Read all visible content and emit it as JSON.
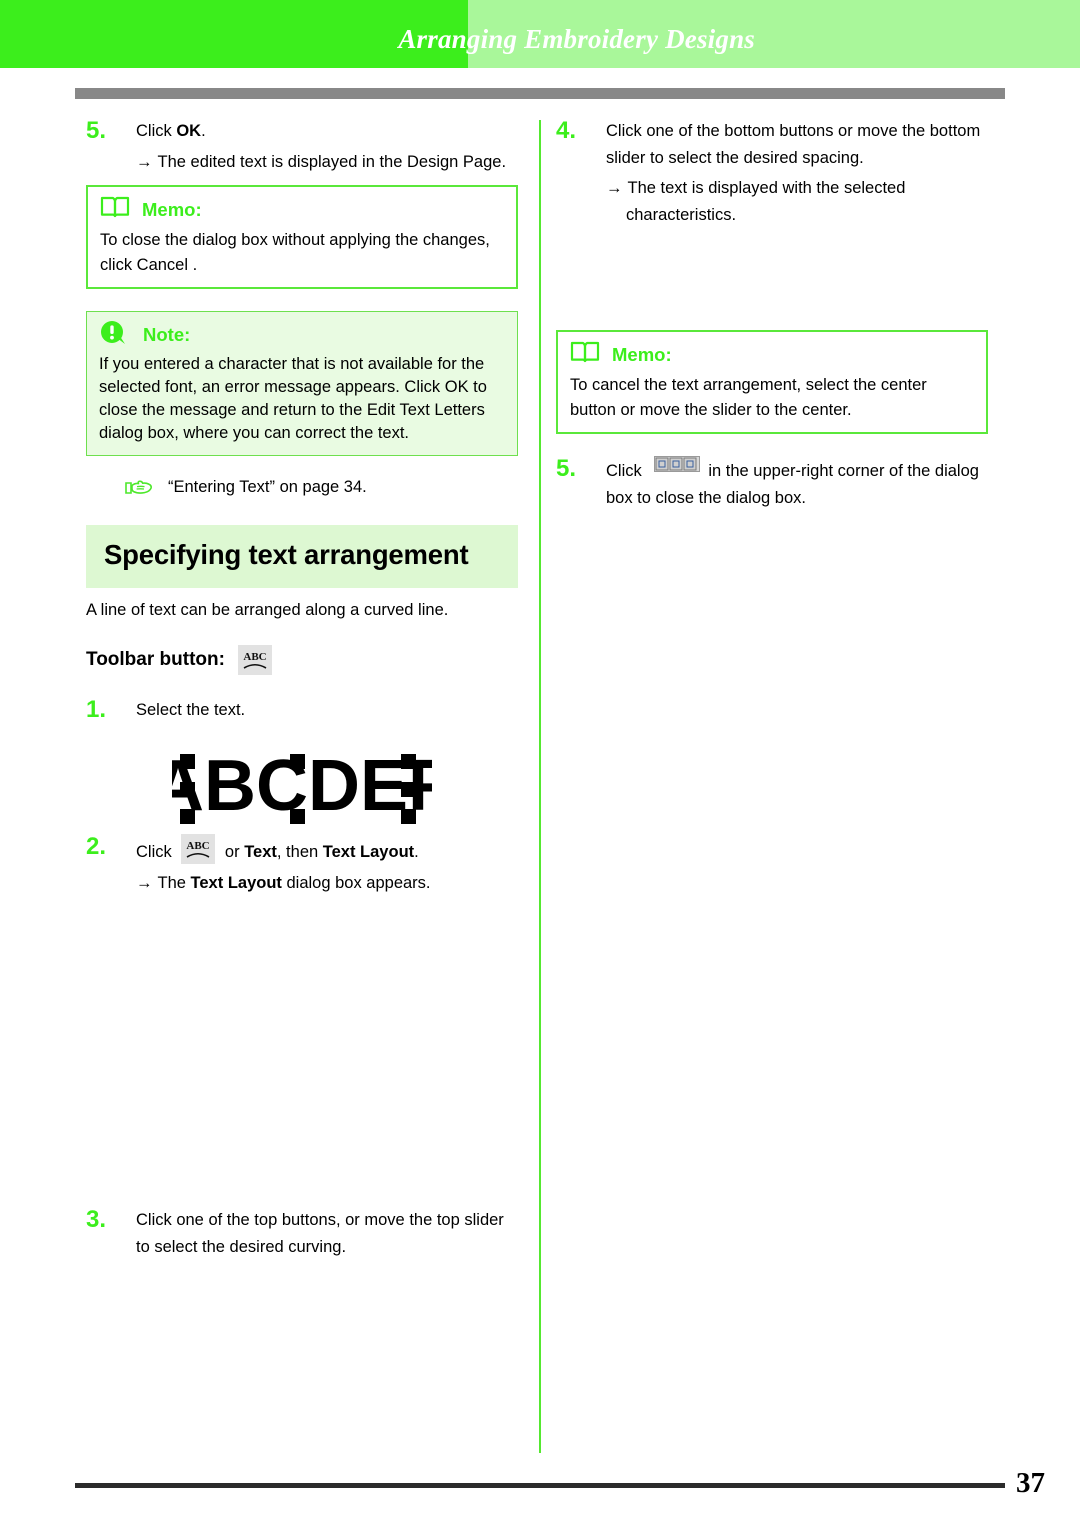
{
  "header": {
    "title": "Arranging Embroidery Designs",
    "accent_dark": "#3cee1c",
    "accent_light": "#a9f79a",
    "rule_color": "#888888"
  },
  "left_column": {
    "step5": {
      "number": "5.",
      "text_prefix": "Click ",
      "text_bold": "OK",
      "text_suffix": ".",
      "arrow": "→",
      "result": "The edited text is displayed in the Design Page."
    },
    "memo": {
      "icon": "book-icon",
      "title": "Memo:",
      "text": "To close the dialog box without applying the changes, click Cancel ."
    },
    "note": {
      "icon": "exclamation-icon",
      "title": "Note:",
      "text": "If you entered a character that is not available for the selected font, an error message appears. Click OK to close the message and return to the Edit Text Letters  dialog box, where you can correct the text."
    },
    "reference": {
      "icon": "pointing-hand-icon",
      "text": "“Entering Text” on page 34."
    },
    "section_heading": "Specifying text arrangement",
    "intro": "A line of text can be arranged along a curved line.",
    "toolbar": {
      "label": "Toolbar button:",
      "icon": "text-layout-abc-icon"
    },
    "step1": {
      "number": "1.",
      "text": "Select the text."
    },
    "artwork": {
      "name": "selected-text-abcdef",
      "letters": "ABCDEF",
      "handle_count": 8
    },
    "step2": {
      "number": "2.",
      "text_prefix": "Click ",
      "icon": "text-layout-abc-icon",
      "text_mid": " or ",
      "bold1": "Text",
      "text_mid2": ", then ",
      "bold2": "Text Layout",
      "text_suffix": ".",
      "arrow": "→",
      "result_prefix": "The ",
      "result_bold": "Text Layout",
      "result_suffix": " dialog box appears."
    },
    "step3": {
      "number": "3.",
      "text": "Click one of the top buttons, or move the top slider to select the desired curving."
    }
  },
  "right_column": {
    "step4": {
      "number": "4.",
      "text": "Click one of the bottom buttons or move the bottom slider to select the desired spacing.",
      "arrow": "→",
      "result": "The text is displayed with the selected characteristics."
    },
    "memo": {
      "icon": "book-icon",
      "title": "Memo:",
      "text": "To cancel the text arrangement, select the center button or move the slider to the center."
    },
    "step5": {
      "number": "5.",
      "text_prefix": "Click ",
      "icon": "window-buttons-icon",
      "text_suffix": "in the upper-right corner of the dialog box to close the dialog box."
    }
  },
  "footer": {
    "page_number": "37"
  }
}
